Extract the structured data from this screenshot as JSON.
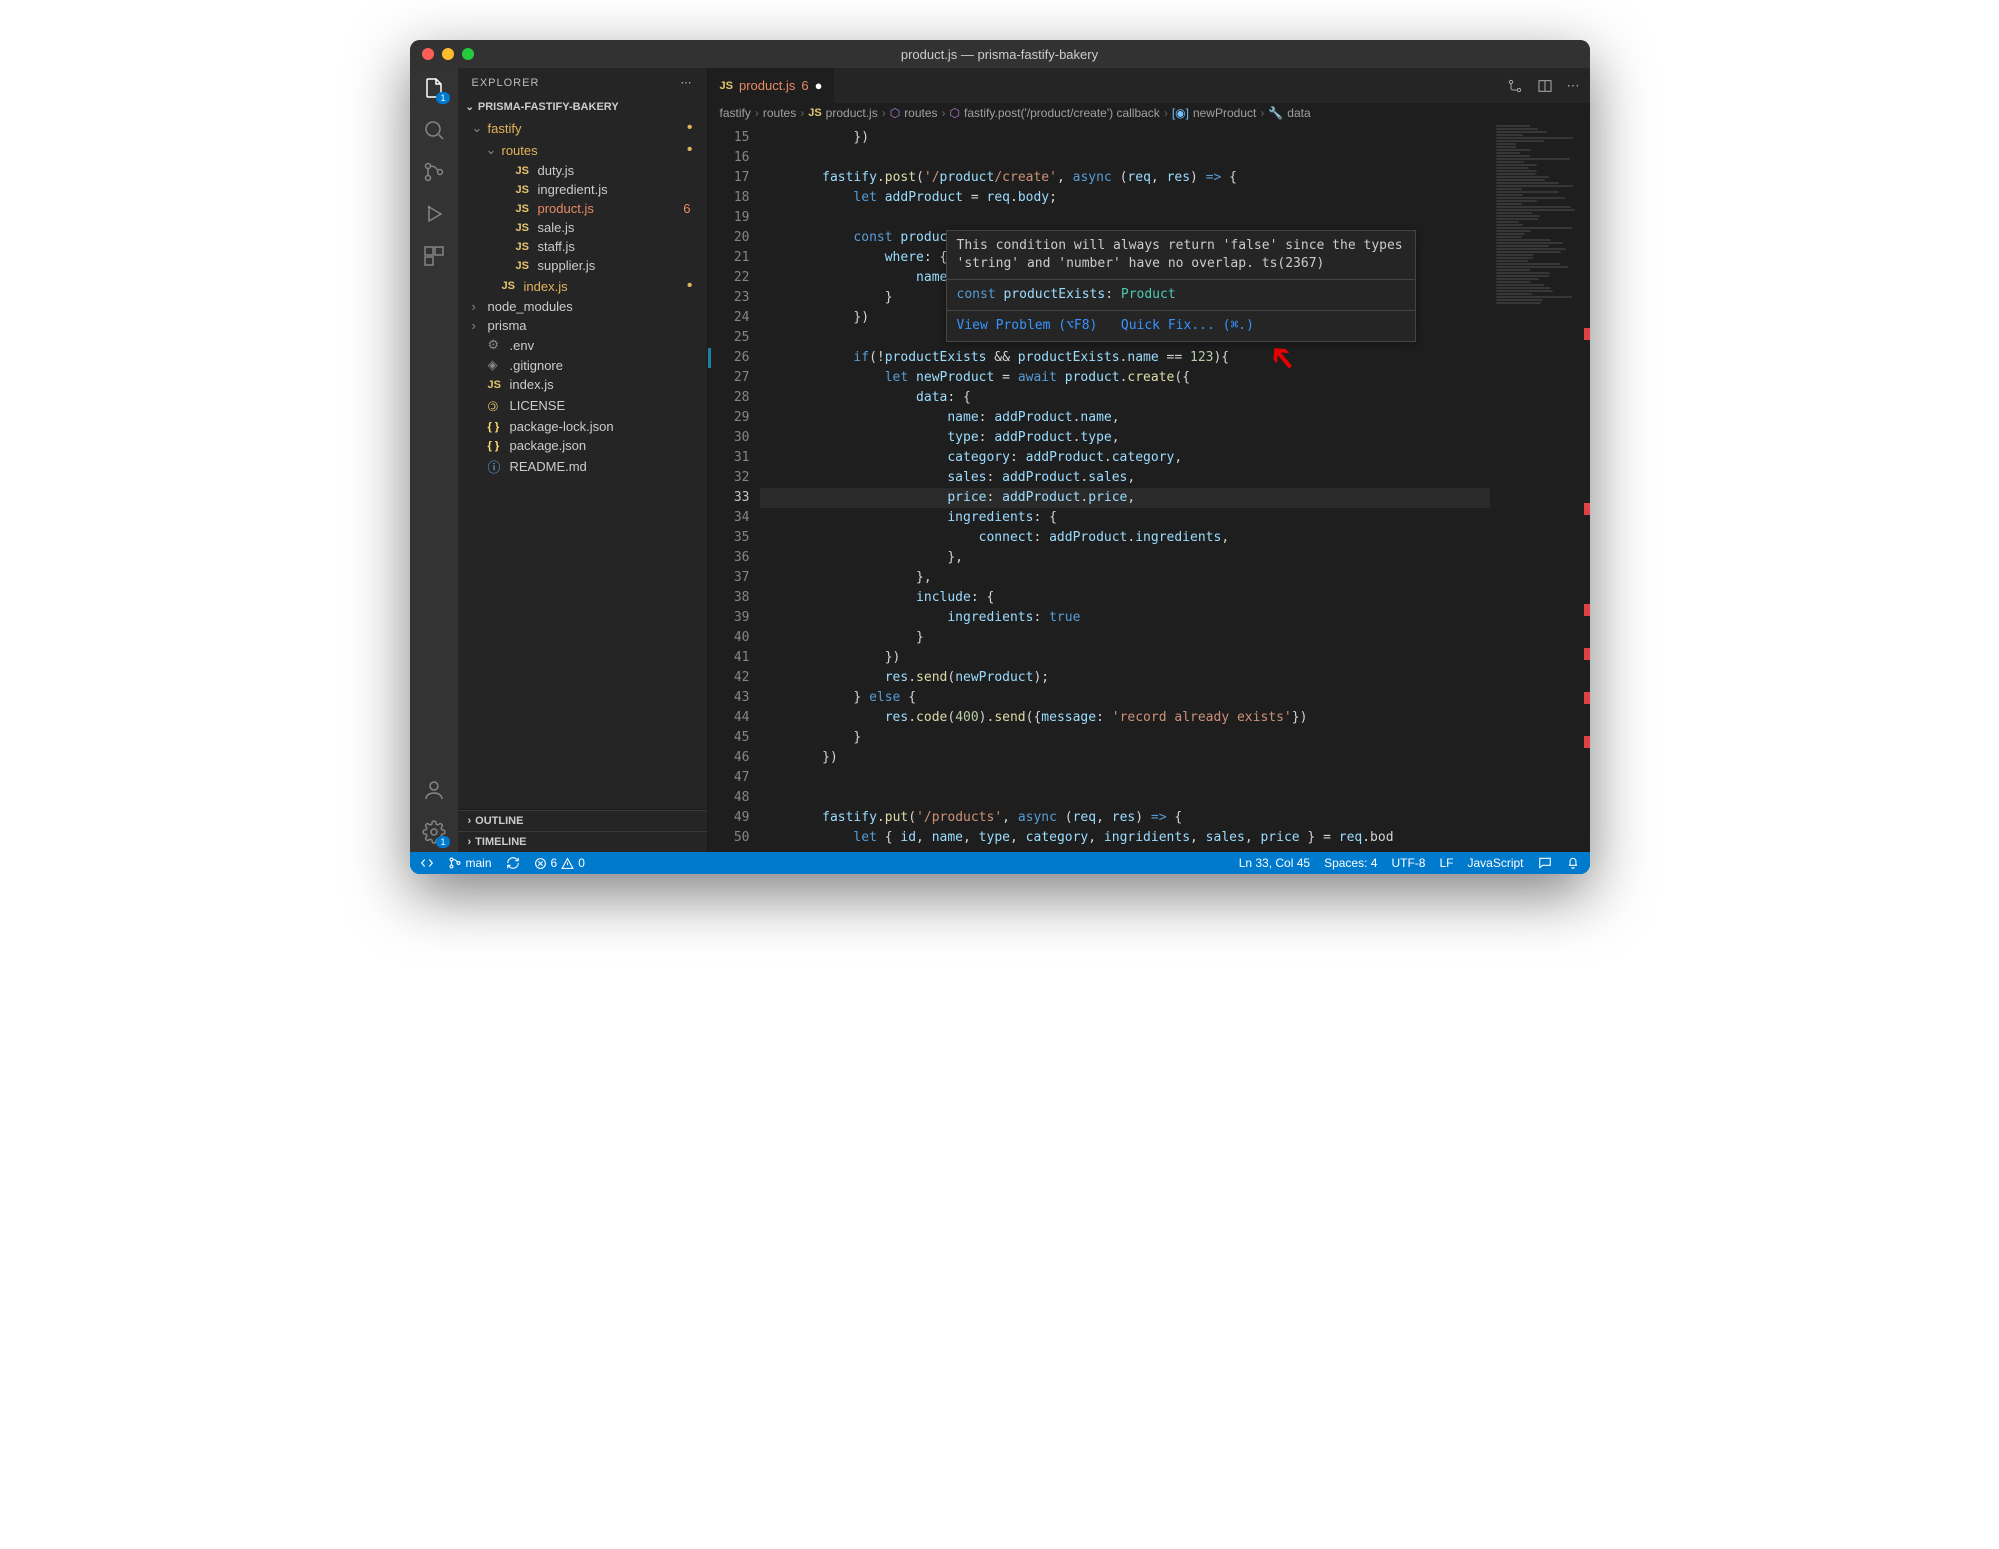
{
  "title": "product.js — prisma-fastify-bakery",
  "explorer": {
    "header": "EXPLORER",
    "project": "PRISMA-FASTIFY-BAKERY",
    "tree": [
      {
        "type": "folder",
        "name": "fastify",
        "indent": 0,
        "open": true,
        "modified": true
      },
      {
        "type": "folder",
        "name": "routes",
        "indent": 1,
        "open": true,
        "modified": true
      },
      {
        "type": "js",
        "name": "duty.js",
        "indent": 2
      },
      {
        "type": "js",
        "name": "ingredient.js",
        "indent": 2
      },
      {
        "type": "js",
        "name": "product.js",
        "indent": 2,
        "active": true,
        "problems": "6"
      },
      {
        "type": "js",
        "name": "sale.js",
        "indent": 2
      },
      {
        "type": "js",
        "name": "staff.js",
        "indent": 2
      },
      {
        "type": "js",
        "name": "supplier.js",
        "indent": 2
      },
      {
        "type": "js",
        "name": "index.js",
        "indent": 1,
        "modified": true
      },
      {
        "type": "folder",
        "name": "node_modules",
        "indent": 0,
        "open": false
      },
      {
        "type": "folder",
        "name": "prisma",
        "indent": 0,
        "open": false
      },
      {
        "type": "gear",
        "name": ".env",
        "indent": 0
      },
      {
        "type": "git",
        "name": ".gitignore",
        "indent": 0
      },
      {
        "type": "js",
        "name": "index.js",
        "indent": 0
      },
      {
        "type": "license",
        "name": "LICENSE",
        "indent": 0
      },
      {
        "type": "json",
        "name": "package-lock.json",
        "indent": 0
      },
      {
        "type": "json",
        "name": "package.json",
        "indent": 0
      },
      {
        "type": "info",
        "name": "README.md",
        "indent": 0
      }
    ],
    "outline": "OUTLINE",
    "timeline": "TIMELINE"
  },
  "activitybar": {
    "explorer_badge": "1",
    "settings_badge": "1"
  },
  "tab": {
    "filename": "product.js",
    "count": "6"
  },
  "breadcrumbs": {
    "items": [
      "fastify",
      "routes",
      "product.js",
      "routes",
      "fastify.post('/product/create') callback",
      "newProduct",
      "data"
    ]
  },
  "code": {
    "first_line": 15,
    "lines": [
      "            })",
      "",
      "        fastify.post('/product/create', async (req, res) => {",
      "            let addProduct = req.body;",
      "",
      "            const productExists = await product.findUnique({",
      "                where: {",
      "                    name: addProd",
      "                }",
      "            })",
      "",
      "            if(!productExists && productExists.name == 123){",
      "                let newProduct = await product.create({",
      "                    data: {",
      "                        name: addProduct.name,",
      "                        type: addProduct.type,",
      "                        category: addProduct.category,",
      "                        sales: addProduct.sales,",
      "                        price: addProduct.price,",
      "                        ingredients: {",
      "                            connect: addProduct.ingredients,",
      "                        },",
      "                    },",
      "                    include: {",
      "                        ingredients: true",
      "                    }",
      "                })",
      "                res.send(newProduct);",
      "            } else {",
      "                res.code(400).send({message: 'record already exists'})",
      "            }",
      "        })",
      "",
      "",
      "        fastify.put('/products', async (req, res) => {",
      "            let { id, name, type, category, ingridients, sales, price } = req.bod"
    ],
    "current_line": 33,
    "breakpoint_at": 26
  },
  "hover": {
    "msg1": "This condition will always return 'false' since the types",
    "msg2": "'string' and 'number' have no overlap. ts(2367)",
    "decl_prefix": "const ",
    "decl_name": "productExists",
    "decl_sep": ": ",
    "decl_type": "Product",
    "action1": "View Problem (⌥F8)",
    "action2": "Quick Fix... (⌘.)"
  },
  "statusbar": {
    "branch": "main",
    "errors": "6",
    "warnings": "0",
    "ln_col": "Ln 33, Col 45",
    "spaces": "Spaces: 4",
    "encoding": "UTF-8",
    "eol": "LF",
    "language": "JavaScript"
  }
}
